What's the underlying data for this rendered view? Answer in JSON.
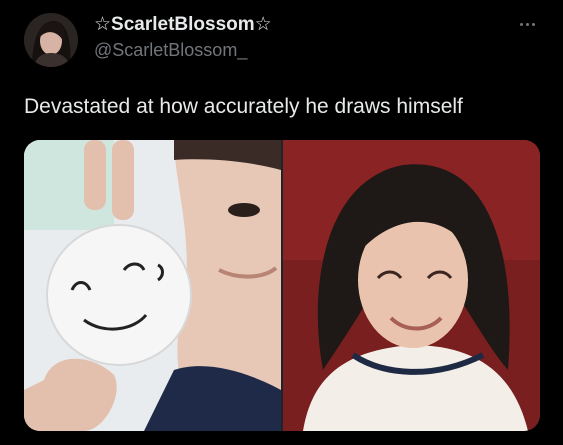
{
  "tweet": {
    "author": {
      "display_name": "☆ScarletBlossom☆",
      "handle": "@ScarletBlossom_",
      "avatar_icon": "profile-avatar"
    },
    "more_icon": "more-options-icon",
    "text": "Devastated at how accurately he draws himself",
    "media": [
      {
        "name": "left-photo",
        "description_icon": "photo-balloon-face"
      },
      {
        "name": "right-photo",
        "description_icon": "photo-smiling-person"
      }
    ]
  },
  "colors": {
    "background": "#000000",
    "primary_text": "#e7e9ea",
    "secondary_text": "#71767b"
  }
}
